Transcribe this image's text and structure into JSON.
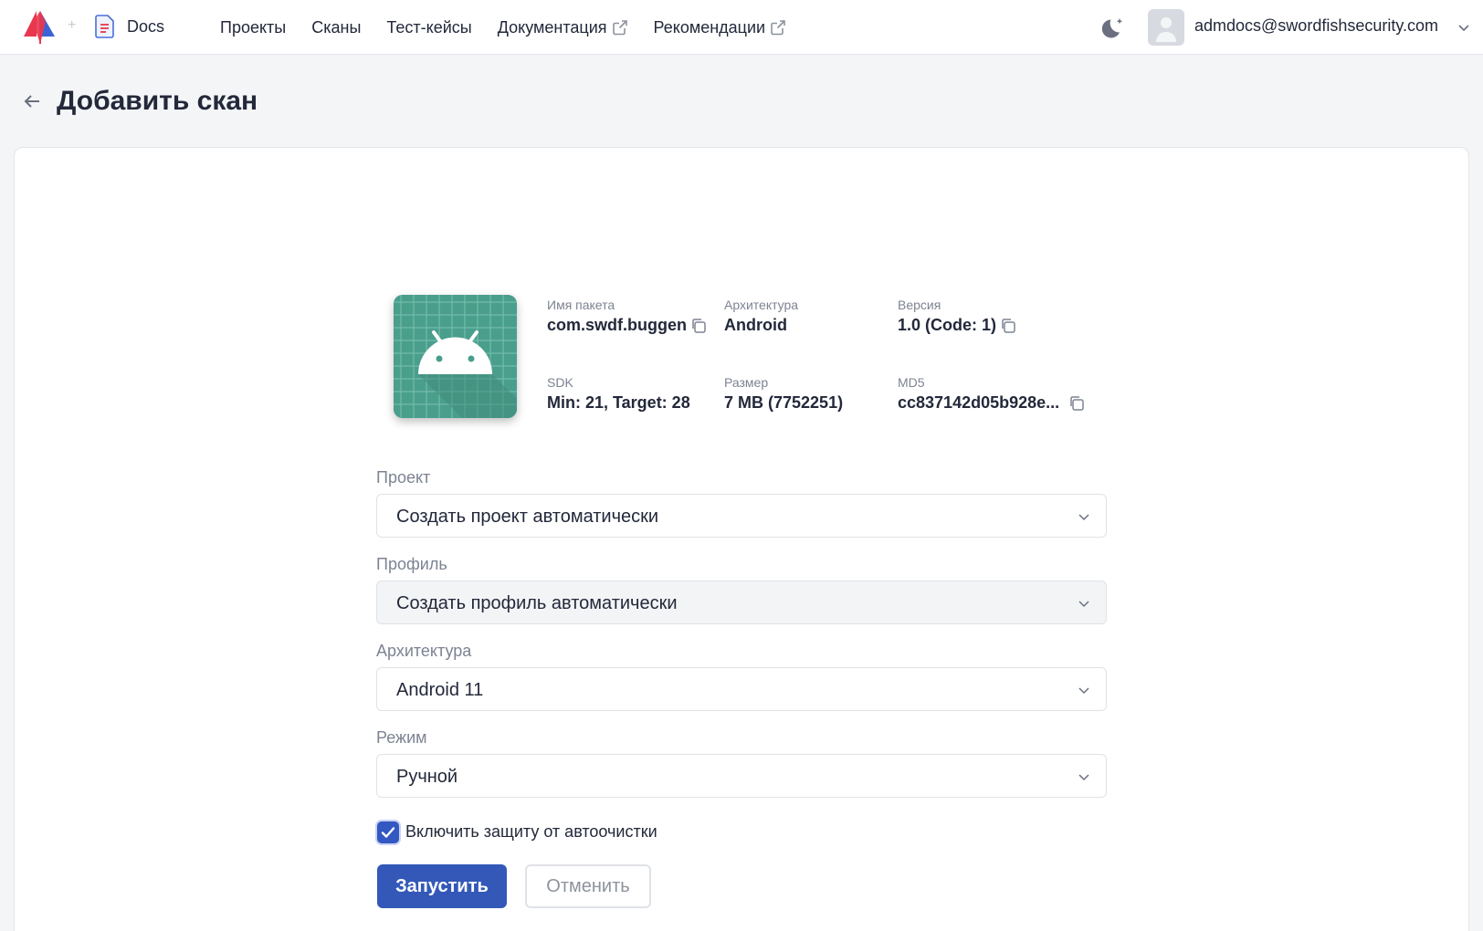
{
  "header": {
    "brand_icon": "app-logo-icon",
    "docs_icon": "document-icon",
    "docs_label": "Docs",
    "nav": [
      {
        "label": "Проекты",
        "external": false
      },
      {
        "label": "Сканы",
        "external": false
      },
      {
        "label": "Тест-кейсы",
        "external": false
      },
      {
        "label": "Документация",
        "external": true
      },
      {
        "label": "Рекомендации",
        "external": true
      }
    ],
    "theme_icon": "moon-icon",
    "user_email": "admdocs@swordfishsecurity.com"
  },
  "page": {
    "title": "Добавить скан"
  },
  "app_info": {
    "package_label": "Имя пакета",
    "package_value": "com.swdf.buggen",
    "architecture_label": "Архитектура",
    "architecture_value": "Android",
    "version_label": "Версия",
    "version_value": "1.0 (Code: 1)",
    "sdk_label": "SDK",
    "sdk_value": "Min: 21, Target: 28",
    "size_label": "Размер",
    "size_value": "7 MB (7752251)",
    "md5_label": "MD5",
    "md5_value": "cc837142d05b928e..."
  },
  "form": {
    "project_label": "Проект",
    "project_value": "Создать проект автоматически",
    "profile_label": "Профиль",
    "profile_value": "Создать профиль автоматически",
    "architecture_label": "Архитектура",
    "architecture_value": "Android 11",
    "mode_label": "Режим",
    "mode_value": "Ручной",
    "autoclean_label": "Включить защиту от автоочистки",
    "autoclean_checked": true,
    "submit_label": "Запустить",
    "cancel_label": "Отменить"
  },
  "colors": {
    "primary": "#3358b8",
    "app_icon_bg": "#4a9e8c",
    "page_bg": "#f4f5f7"
  }
}
